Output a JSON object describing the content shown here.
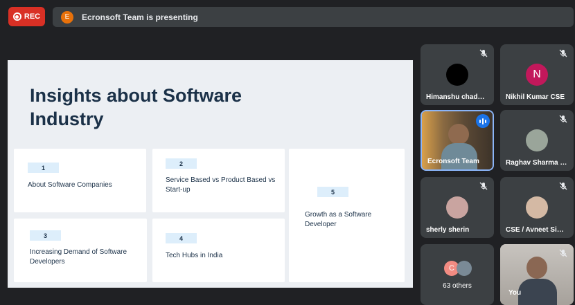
{
  "recording": {
    "label": "REC"
  },
  "banner": {
    "avatar_letter": "E",
    "text": "Ecronsoft Team is presenting"
  },
  "slide": {
    "title": "Insights about Software Industry",
    "cards": [
      {
        "number": "1",
        "text": "About Software Companies"
      },
      {
        "number": "2",
        "text": "Service Based vs Product Based vs Start-up"
      },
      {
        "number": "3",
        "text": "Increasing Demand of Software Developers"
      },
      {
        "number": "4",
        "text": "Tech Hubs in India"
      },
      {
        "number": "5",
        "text": "Growth as a Software Developer"
      }
    ]
  },
  "participants": [
    {
      "name": "Himanshu chad…",
      "muted": true
    },
    {
      "name": "Nikhil Kumar CSE",
      "avatar_letter": "N",
      "avatar_color": "#c2185b",
      "muted": true
    },
    {
      "name": "Ecronsoft Team",
      "speaking": true
    },
    {
      "name": "Raghav Sharma …",
      "muted": true
    },
    {
      "name": "sherly sherin",
      "muted": true
    },
    {
      "name": "CSE / Avneet Si…",
      "muted": true
    },
    {
      "name": "63 others",
      "avatar_letter": "C",
      "avatar_color": "#f28b82"
    },
    {
      "name": "You",
      "muted": true
    }
  ],
  "colors": {
    "rec": "#d93025",
    "tile_bg": "#3c4043",
    "page_bg": "#202124",
    "slide_title": "#1b3148",
    "speaking_border": "#8ab4f8"
  }
}
